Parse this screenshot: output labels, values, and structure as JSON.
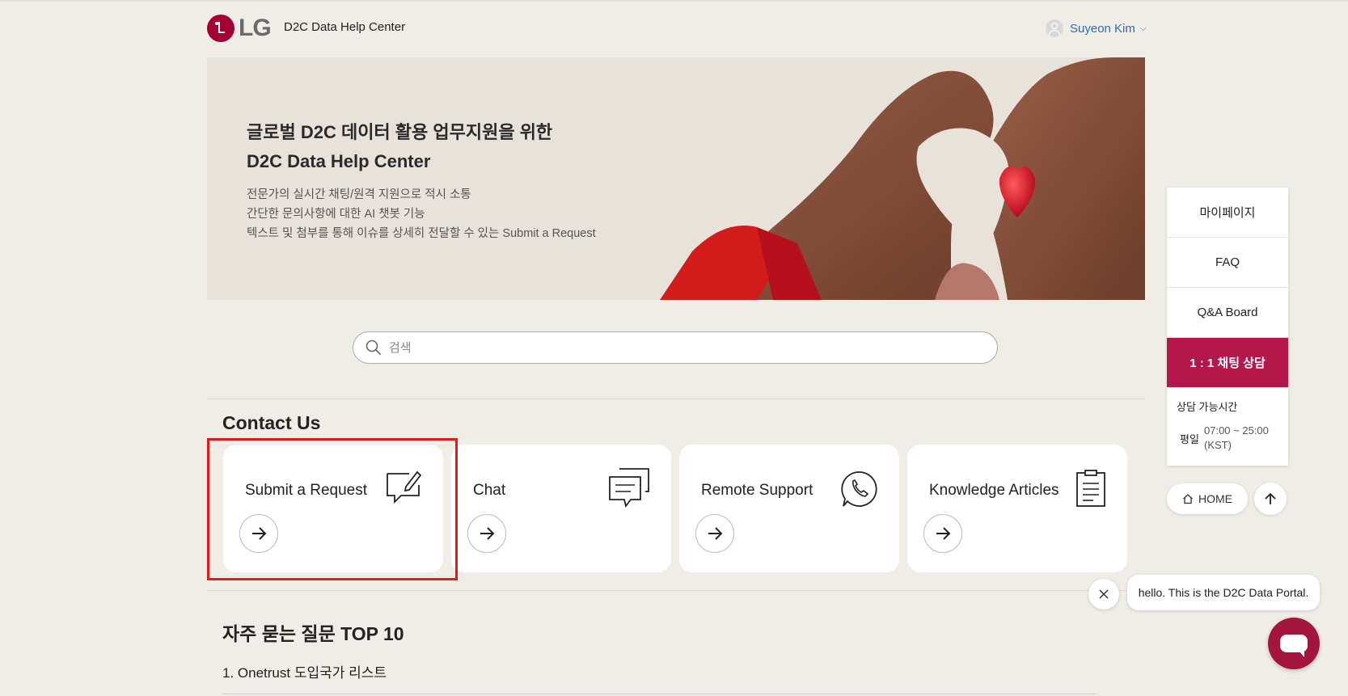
{
  "header": {
    "logo_text": "LG",
    "site_title": "D2C Data Help Center",
    "user_name": "Suyeon Kim"
  },
  "hero": {
    "title_line1": "글로벌 D2C 데이터 활용 업무지원을 위한",
    "title_line2": "D2C Data Help Center",
    "desc_line1": "전문가의 실시간 채팅/원격 지원으로 적시 소통",
    "desc_line2": "간단한 문의사항에 대한 AI 챗봇 기능",
    "desc_line3": "텍스트 및 첨부를 통해 이슈를 상세히 전달할 수 있는 Submit a Request"
  },
  "search": {
    "placeholder": "검색"
  },
  "contact": {
    "title": "Contact Us",
    "cards": [
      {
        "label": "Submit a Request",
        "icon": "edit-message-icon"
      },
      {
        "label": "Chat",
        "icon": "chat-bubbles-icon"
      },
      {
        "label": "Remote Support",
        "icon": "phone-icon"
      },
      {
        "label": "Knowledge Articles",
        "icon": "clipboard-icon"
      }
    ]
  },
  "faq": {
    "title": "자주 묻는 질문 TOP 10",
    "items": [
      "1. Onetrust 도입국가 리스트"
    ]
  },
  "side_menu": {
    "items": [
      "마이페이지",
      "FAQ",
      "Q&A Board",
      "1 : 1 채팅 상담"
    ],
    "hours_title": "상담 가능시간",
    "hours_days": "평일",
    "hours_time": "07:00 ~ 25:00",
    "hours_zone": "(KST)"
  },
  "buttons": {
    "home": "HOME"
  },
  "chat_widget": {
    "message": "hello. This is the D2C Data Portal."
  },
  "colors": {
    "brand": "#a50034",
    "chat_accent": "#b5174b",
    "highlight": "#e21a1a",
    "background": "#f0ece6"
  }
}
